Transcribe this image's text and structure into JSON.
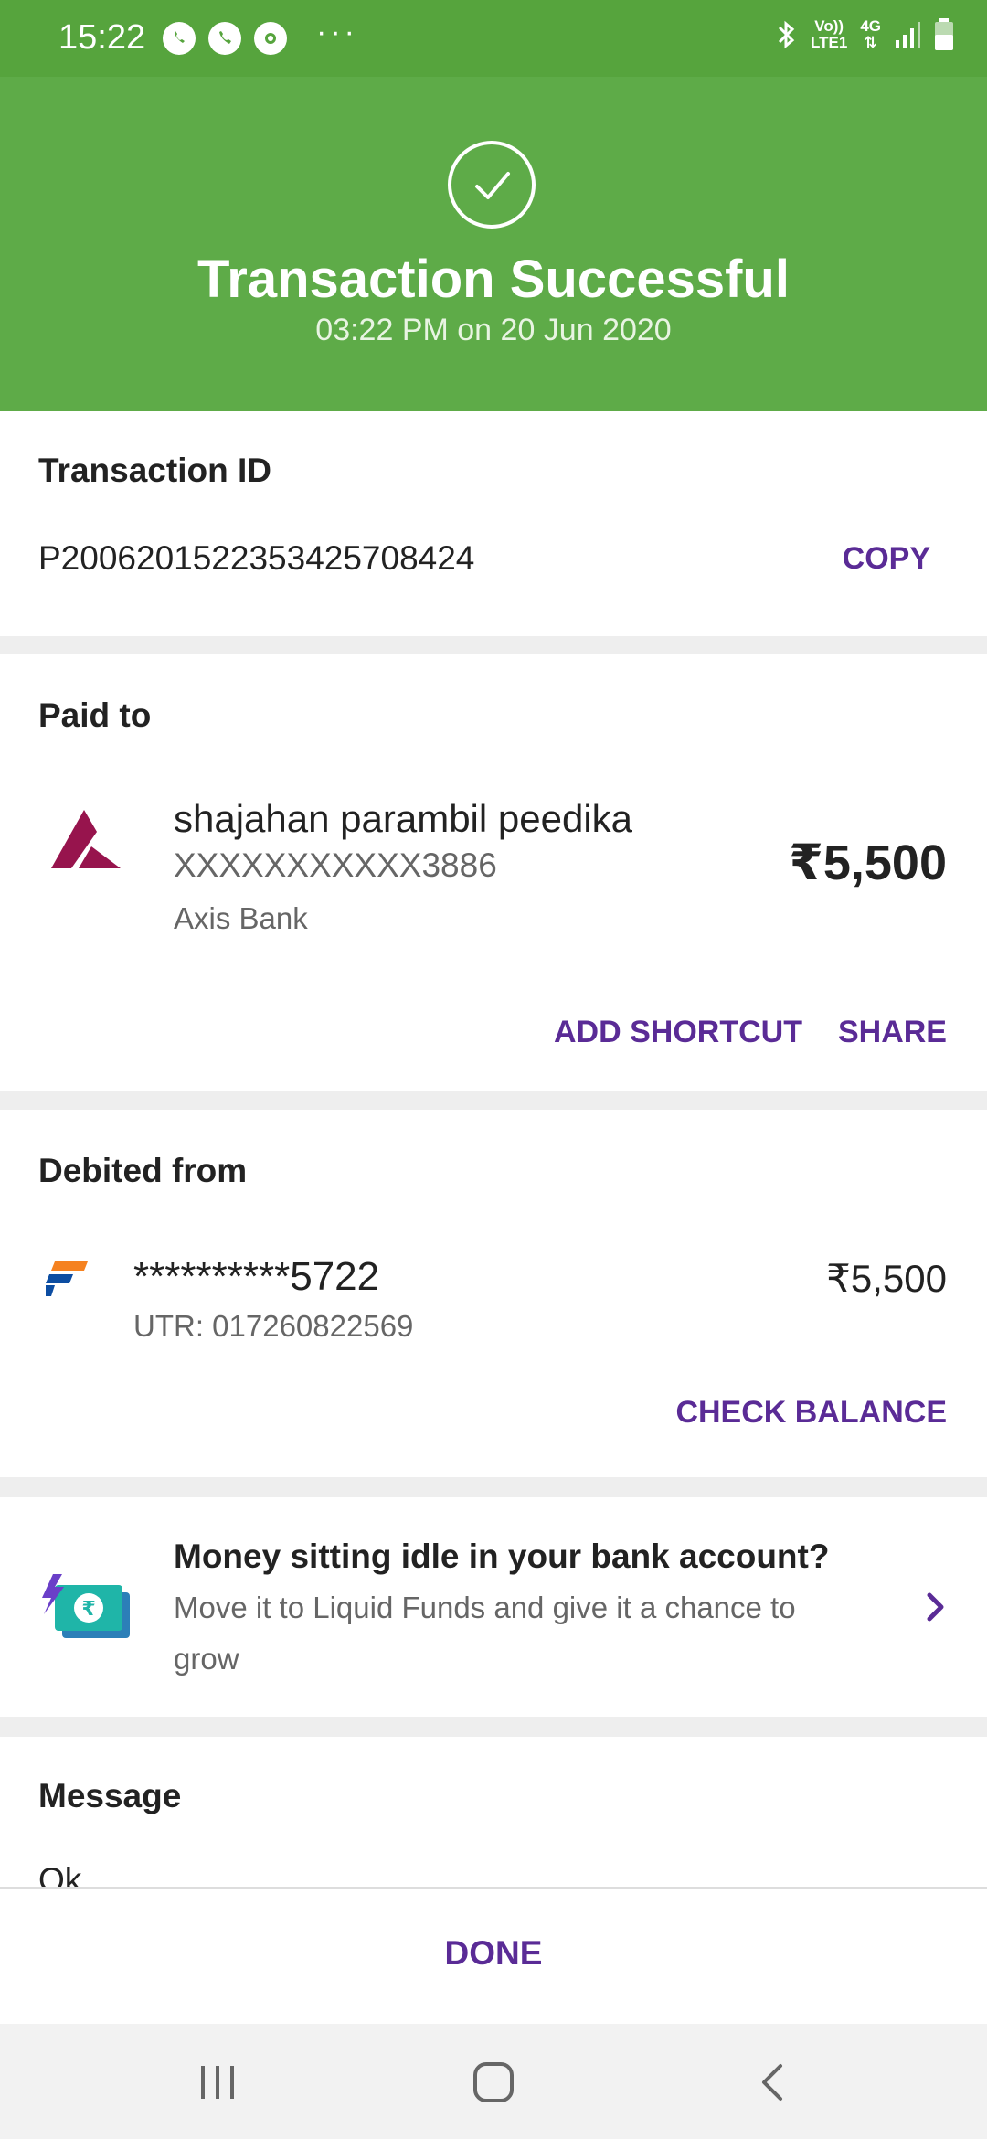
{
  "status_bar": {
    "time": "15:22",
    "volte": "Vo))",
    "lte": "LTE1",
    "network": "4G"
  },
  "header": {
    "title": "Transaction Successful",
    "datetime": "03:22 PM on 20 Jun 2020",
    "bg_color": "#5eab48"
  },
  "transaction": {
    "label": "Transaction ID",
    "id": "P2006201522353425708424",
    "copy_label": "COPY"
  },
  "paid_to": {
    "label": "Paid to",
    "name": "shajahan parambil peedika",
    "account": "XXXXXXXXXXX3886",
    "bank": "Axis Bank",
    "amount": "₹5,500",
    "add_shortcut_label": "ADD SHORTCUT",
    "share_label": "SHARE"
  },
  "debited_from": {
    "label": "Debited from",
    "account": "**********5722",
    "utr": "UTR: 017260822569",
    "amount": "₹5,500",
    "check_balance_label": "CHECK BALANCE"
  },
  "promo": {
    "title": "Money sitting idle in your bank account?",
    "line1": "Move it to Liquid Funds and give it a chance to",
    "line2": "grow",
    "icon": "money-icon"
  },
  "message": {
    "label": "Message",
    "text": "Ok"
  },
  "footer": {
    "done_label": "DONE"
  },
  "colors": {
    "accent": "#5a2b96",
    "success": "#5eab48"
  }
}
